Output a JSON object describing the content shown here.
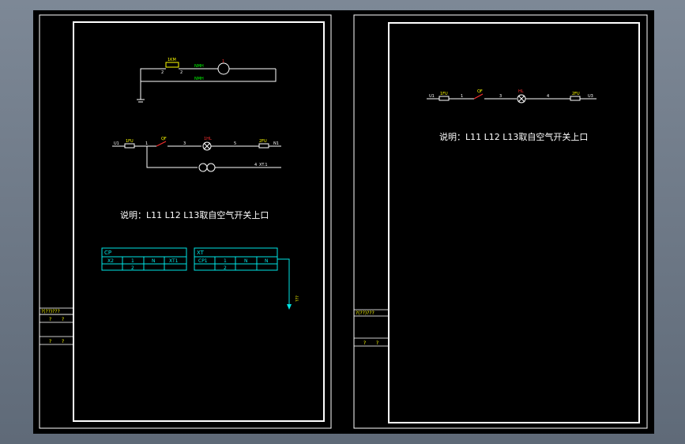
{
  "left_sheet": {
    "circuit1": {
      "label_top": "1KM",
      "node_left": "2",
      "node_right": "2",
      "lamp_label": "1",
      "wire_label_top": "NMH",
      "wire_label_bottom": "NMH"
    },
    "circuit2": {
      "start_label": "U1",
      "fuse_label": "1FU",
      "node1": "1",
      "switch_label": "QF",
      "node2": "3",
      "lamp_label": "1HL",
      "node3": "5",
      "fuse2_label": "2FU",
      "end_label": "N1",
      "branch_node": "4",
      "branch_end": "XT.1"
    },
    "note": "说明：L11  L12  L13取自空气开关上口",
    "table_cp": {
      "title": "CP",
      "headers": [
        "X2",
        "1",
        "N",
        "XT1"
      ],
      "values": [
        "",
        "2",
        "",
        ""
      ]
    },
    "table_xt": {
      "title": "XT",
      "headers": [
        "CP1",
        "1",
        "N",
        "N"
      ],
      "values": [
        "",
        "2",
        "",
        ""
      ]
    },
    "arrow_label": "???",
    "titleblock": {
      "row1": "?(??)???",
      "row2a": "?",
      "row2b": "?",
      "row3a": "?",
      "row3b": "?"
    }
  },
  "right_sheet": {
    "circuit": {
      "start_label": "U1",
      "fuse_label": "1FU",
      "node1": "1",
      "switch_label": "QF",
      "node2": "3",
      "lamp_label": "HL",
      "node3": "4",
      "fuse2_label": "2FU",
      "end_label": "U3"
    },
    "note": "说明：L11  L12  L13取自空气开关上口",
    "titleblock": {
      "row1": "?(??)???",
      "row2a": "?",
      "row2b": "?"
    }
  },
  "colors": {
    "background": "#000000",
    "frame": "#ffffff",
    "wire": "#00ff00",
    "table": "#00e5e5",
    "label": "#ffff00",
    "switch": "#ff3030"
  }
}
